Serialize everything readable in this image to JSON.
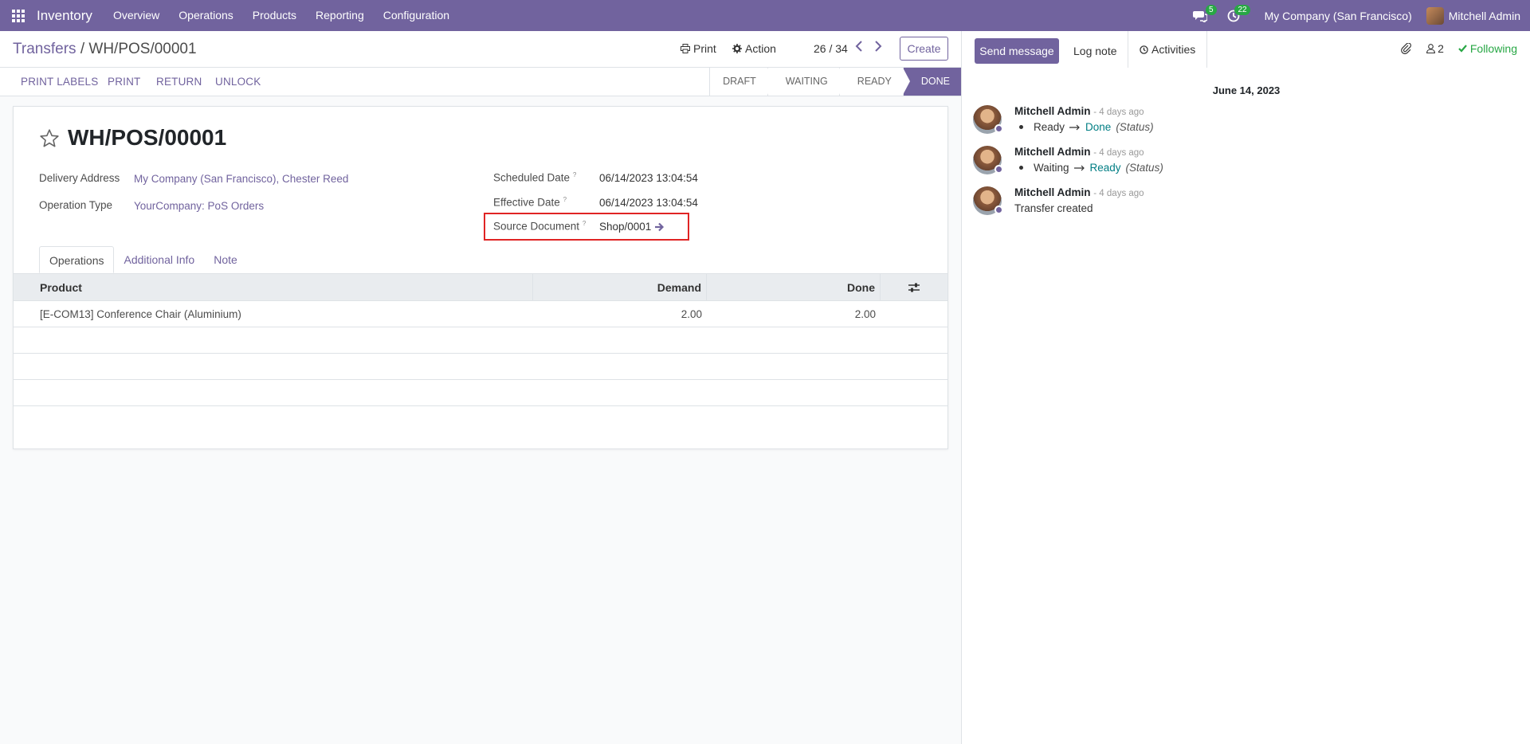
{
  "navbar": {
    "app_name": "Inventory",
    "menu": [
      "Overview",
      "Operations",
      "Products",
      "Reporting",
      "Configuration"
    ],
    "messages_count": "5",
    "activities_count": "22",
    "company": "My Company (San Francisco)",
    "user": "Mitchell Admin"
  },
  "control": {
    "breadcrumb_parent": "Transfers",
    "breadcrumb_sep": " / ",
    "breadcrumb_current": "WH/POS/00001",
    "print_label": "Print",
    "action_label": "Action",
    "pager": "26 / 34",
    "create_label": "Create"
  },
  "statusbar": {
    "buttons": [
      "PRINT LABELS",
      "PRINT",
      "RETURN",
      "UNLOCK"
    ],
    "stages": [
      "DRAFT",
      "WAITING",
      "READY",
      "DONE"
    ],
    "active_stage": "DONE"
  },
  "form": {
    "title": "WH/POS/00001",
    "delivery_address_label": "Delivery Address",
    "delivery_address": "My Company (San Francisco), Chester Reed",
    "operation_type_label": "Operation Type",
    "operation_type": "YourCompany: PoS Orders",
    "scheduled_date_label": "Scheduled Date",
    "scheduled_date": "06/14/2023 13:04:54",
    "effective_date_label": "Effective Date",
    "effective_date": "06/14/2023 13:04:54",
    "source_document_label": "Source Document",
    "source_document": "Shop/0001",
    "help_mark": "?"
  },
  "tabs": [
    "Operations",
    "Additional Info",
    "Note"
  ],
  "table": {
    "headers": {
      "product": "Product",
      "demand": "Demand",
      "done": "Done"
    },
    "rows": [
      {
        "product": "[E-COM13] Conference Chair (Aluminium)",
        "demand": "2.00",
        "done": "2.00"
      }
    ]
  },
  "chatter": {
    "send_message": "Send message",
    "log_note": "Log note",
    "activities": "Activities",
    "followers_count": "2",
    "following": "Following",
    "date": "June 14, 2023",
    "messages": [
      {
        "author": "Mitchell Admin",
        "date": "- 4 days ago",
        "old": "Ready",
        "new": "Done",
        "field": "(Status)"
      },
      {
        "author": "Mitchell Admin",
        "date": "- 4 days ago",
        "old": "Waiting",
        "new": "Ready",
        "field": "(Status)"
      },
      {
        "author": "Mitchell Admin",
        "date": "- 4 days ago",
        "text": "Transfer created"
      }
    ]
  },
  "colors": {
    "brand": "#71639e",
    "success": "#28a745",
    "highlight": "#e02424",
    "status_new": "#017e84"
  }
}
